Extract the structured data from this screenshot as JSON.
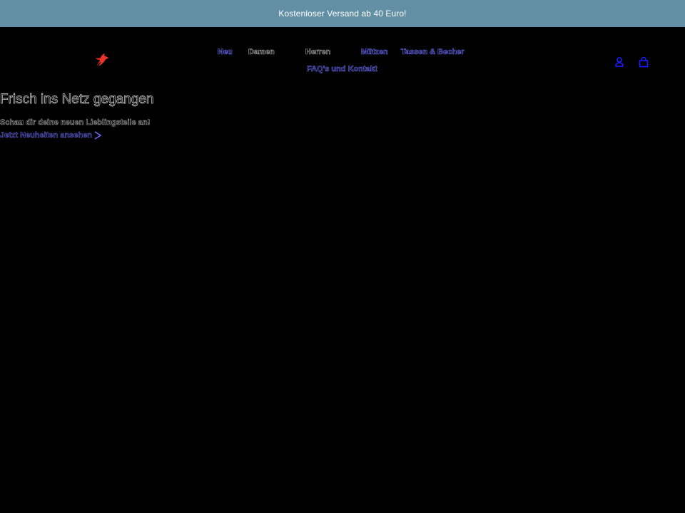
{
  "announcement": {
    "text": "Kostenloser Versand ab 40 Euro!",
    "background": "#628fa3"
  },
  "header": {
    "logo_icon": "bird-logo-icon",
    "logo_color": "#e8322a",
    "nav": [
      {
        "label": "Neu"
      },
      {
        "label": "Damen"
      },
      {
        "label": "Herren"
      },
      {
        "label": "Mützen"
      },
      {
        "label": "Tassen & Becher"
      },
      {
        "label": "FAQ's und Kontakt"
      }
    ],
    "account_icon": "account-icon",
    "cart_icon": "cart-icon",
    "icon_color": "#1a1aff"
  },
  "hero": {
    "title": "Frisch ins Netz gegangen",
    "subtitle": "Schau dir deine neuen Lieblingsteile an!",
    "link_label": "Jetzt Neuheiten ansehen",
    "link_icon": "arrow-right-icon"
  },
  "colors": {
    "link_outline": "#7070ff",
    "text_outline": "#b0b0b0",
    "page_background": "#000000"
  }
}
